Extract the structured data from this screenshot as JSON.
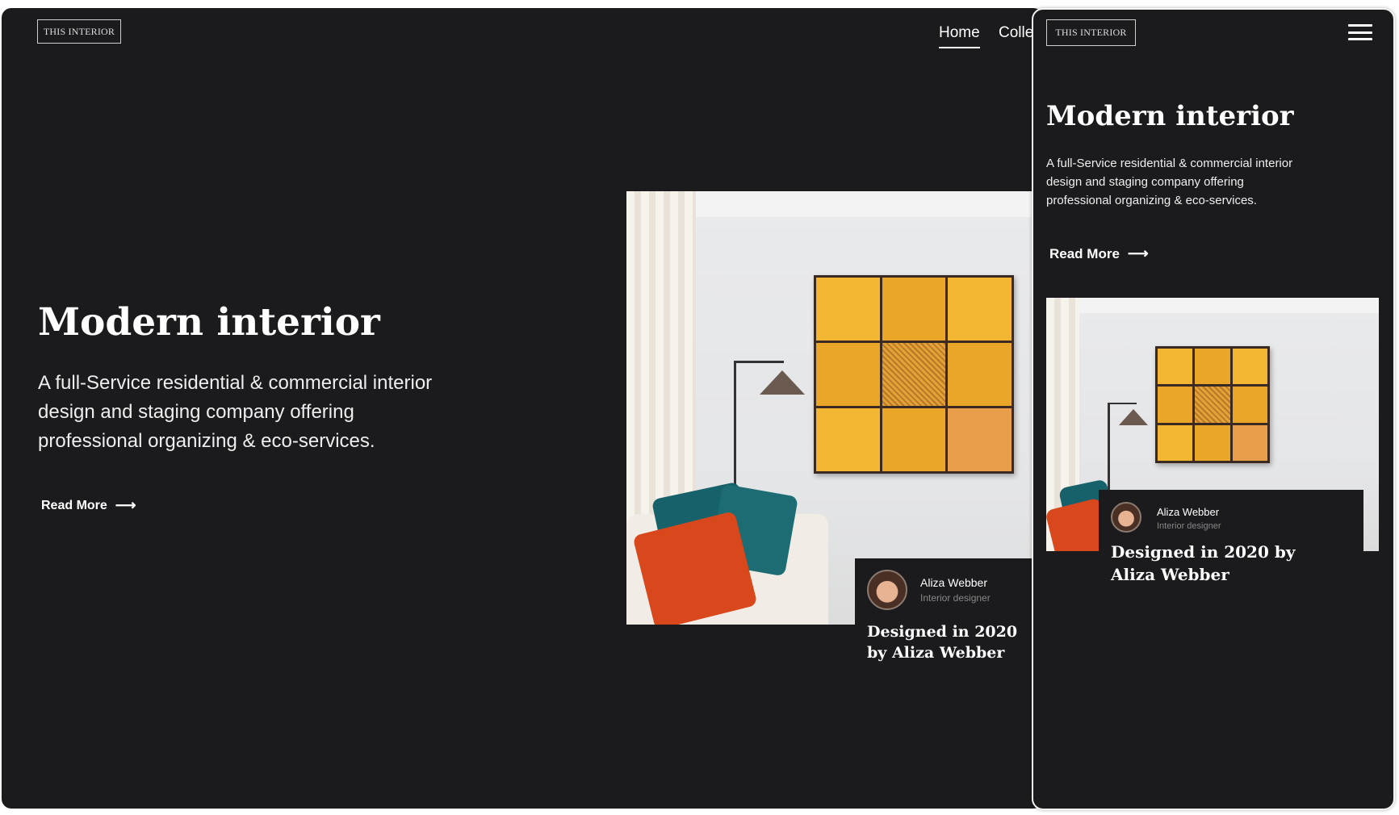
{
  "desktop": {
    "logo": "THIS INTERIOR",
    "nav": [
      {
        "label": "Home",
        "active": true
      },
      {
        "label": "Colle"
      }
    ],
    "hero": {
      "title": "Modern interior",
      "description": "A full-Service residential & commercial interior design and staging company offering professional organizing & eco-services.",
      "read_more": "Read More",
      "arrow": "⟶"
    },
    "caption": {
      "name": "Aliza Webber",
      "role": "Interior designer",
      "title": "Designed in 2020 by Aliza Webber"
    }
  },
  "mobile": {
    "logo": "THIS INTERIOR",
    "menu_icon": "hamburger-icon",
    "hero": {
      "title": "Modern interior",
      "description": "A full-Service residential & commercial interior design and staging company offering professional organizing & eco-services.",
      "read_more": "Read More",
      "arrow": "⟶"
    },
    "caption": {
      "name": "Aliza Webber",
      "role": "Interior designer",
      "title": "Designed in 2020 by Aliza Webber"
    }
  }
}
